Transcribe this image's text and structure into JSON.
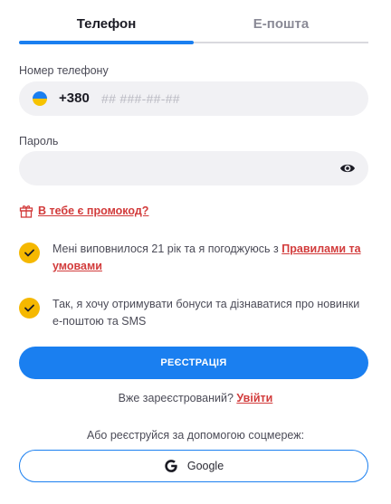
{
  "tabs": [
    {
      "label": "Телефон",
      "active": true
    },
    {
      "label": "Е-пошта",
      "active": false
    }
  ],
  "phone": {
    "label": "Номер телефону",
    "prefix": "+380",
    "placeholder": "## ###-##-##",
    "flag_icon": "ukraine-flag-icon"
  },
  "password": {
    "label": "Пароль",
    "value": "",
    "eye_icon": "eye-icon"
  },
  "promo": {
    "label": "В тебе є промокод?",
    "icon": "gift-icon"
  },
  "consent": {
    "age_text": "Мені виповнилося 21 рік та я погоджуюсь з ",
    "age_link": "Правилами та умовами",
    "bonus_text": "Так, я хочу отримувати бонуси та дізнаватися про новинки е-поштою та SMS"
  },
  "register_button": "РЕЄСТРАЦІЯ",
  "login": {
    "text": "Вже зареєстрований? ",
    "link": "Увійти"
  },
  "social": {
    "text": "Або реєструйся за допомогою соцмереж:",
    "google_label": "Google"
  },
  "colors": {
    "accent": "#1a7ff0",
    "link": "#d23b3b",
    "checkbox": "#f5b800",
    "field_bg": "#f1f1f4"
  }
}
